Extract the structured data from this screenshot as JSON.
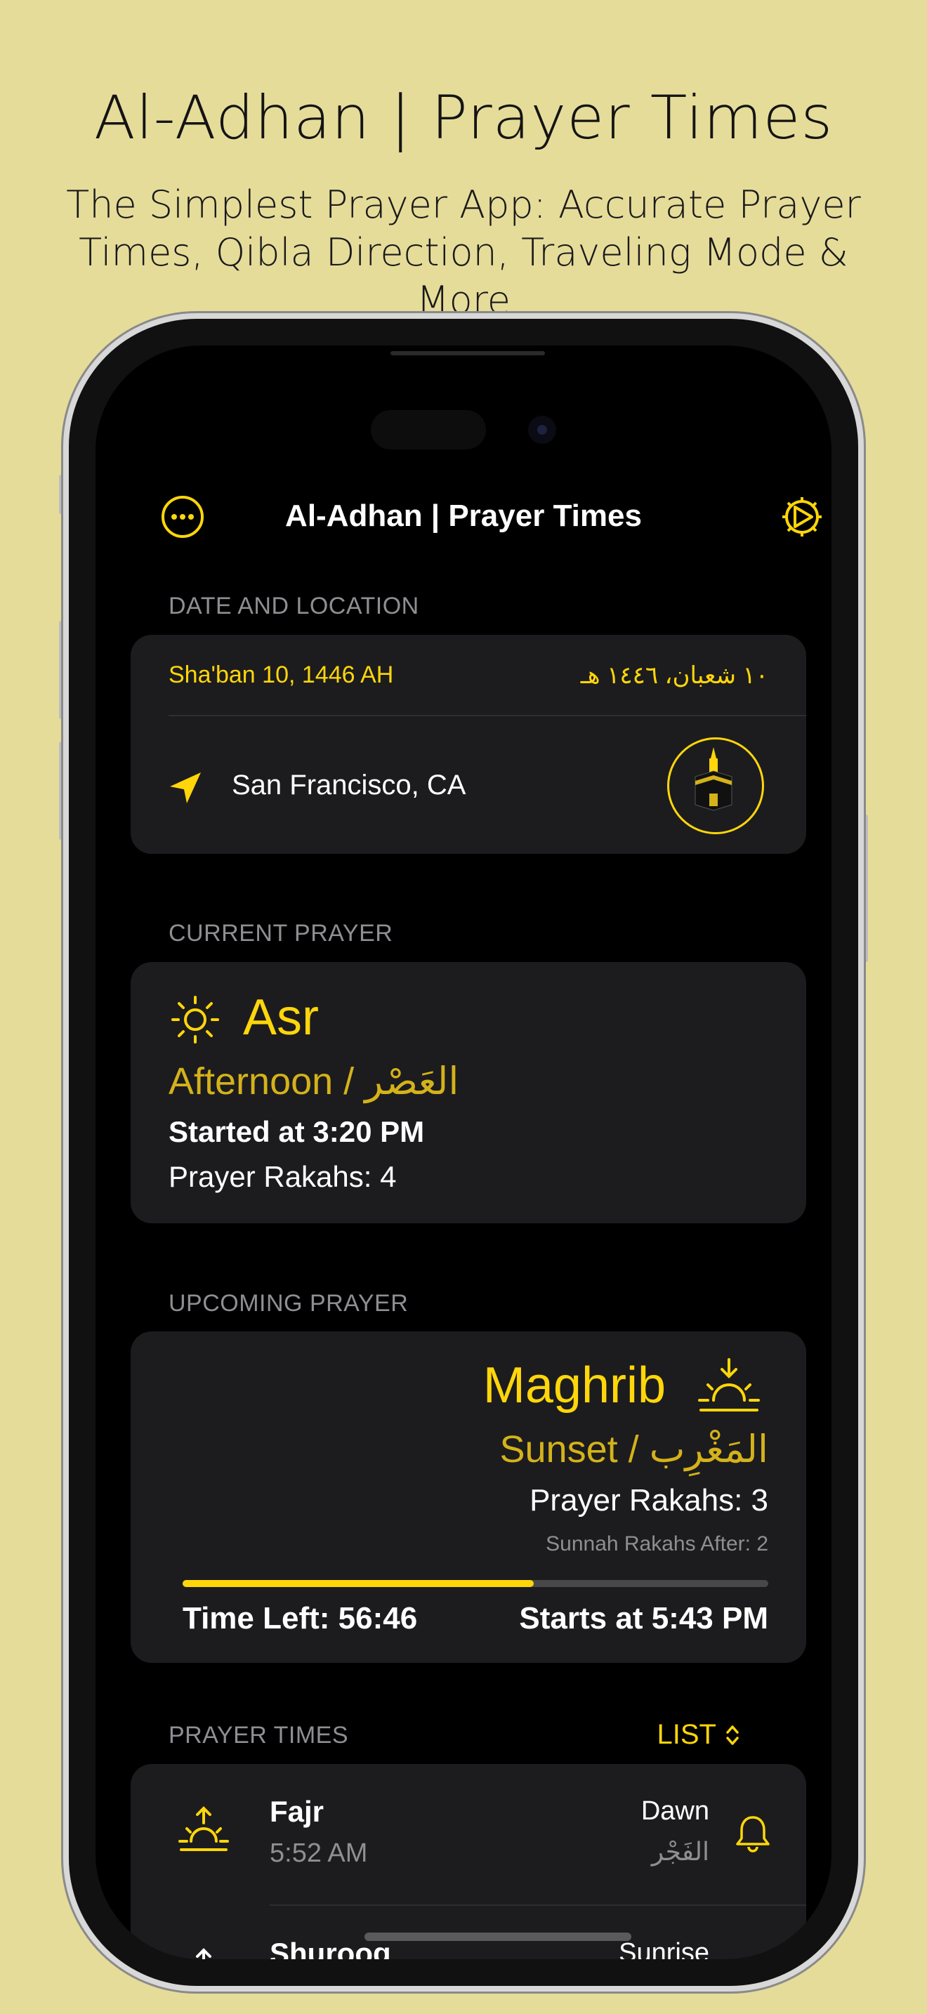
{
  "marketing": {
    "title": "Al-Adhan | Prayer Times",
    "subtitle_line1": "The Simplest Prayer App: Accurate Prayer",
    "subtitle_line2": "Times, Qibla Direction, Traveling Mode & More"
  },
  "app": {
    "nav_title": "Al-Adhan | Prayer Times",
    "more_icon": "ellipsis-circle-icon",
    "settings_icon": "gear-icon"
  },
  "date_location": {
    "section_label": "DATE AND LOCATION",
    "hijri_en": "Sha'ban 10, 1446 AH",
    "hijri_ar": "١٠ شعبان، ١٤٤٦ هـ",
    "location_icon": "location-arrow-icon",
    "location": "San Francisco, CA",
    "qibla_icon": "kaaba-icon"
  },
  "current_prayer": {
    "section_label": "CURRENT PRAYER",
    "icon": "sun-icon",
    "name": "Asr",
    "subtitle": "Afternoon / العَصْر",
    "started": "Started at 3:20 PM",
    "rakahs": "Prayer Rakahs: 4"
  },
  "upcoming_prayer": {
    "section_label": "UPCOMING PRAYER",
    "icon": "sunset-icon",
    "name": "Maghrib",
    "subtitle": "Sunset / المَغْرِب",
    "rakahs": "Prayer Rakahs: 3",
    "sunnah": "Sunnah Rakahs After: 2",
    "progress_fraction": 0.6,
    "time_left": "Time Left: 56:46",
    "starts": "Starts at 5:43 PM"
  },
  "prayer_times": {
    "section_label": "PRAYER TIMES",
    "toggle_label": "LIST",
    "rows": [
      {
        "name": "Fajr",
        "time": "5:52 AM",
        "en": "Dawn",
        "ar": "الفَجْر",
        "icon": "sunrise-icon"
      },
      {
        "name": "Shuroog",
        "time": "",
        "en": "Sunrise",
        "ar": "",
        "icon": "sun-rising-icon"
      }
    ]
  },
  "colors": {
    "accent": "#ffd60a",
    "accent_muted": "#d4b21a",
    "background": "#e6dc9a",
    "card": "#1c1c1e"
  }
}
